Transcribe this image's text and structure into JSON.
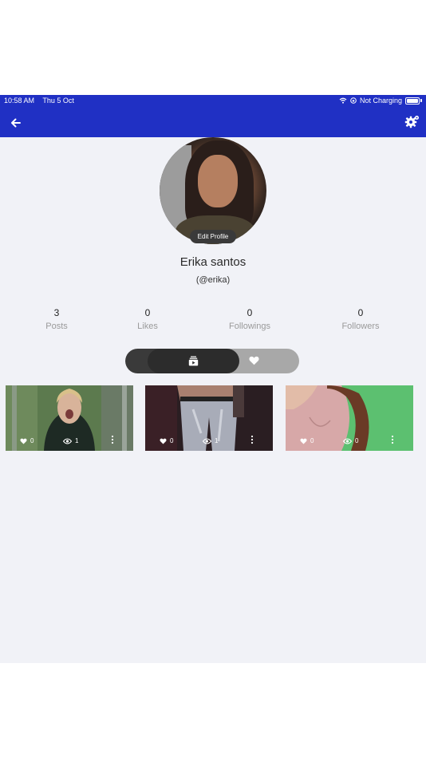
{
  "status_bar": {
    "time": "10:58 AM",
    "date": "Thu 5 Oct",
    "charging": "Not Charging"
  },
  "top_bar": {
    "back_icon": "arrow-left-icon",
    "settings_icon": "gear-icon"
  },
  "profile": {
    "edit_label": "Edit Profile",
    "name": "Erika santos",
    "handle": "(@erika)"
  },
  "stats": [
    {
      "value": "3",
      "label": "Posts"
    },
    {
      "value": "0",
      "label": "Likes"
    },
    {
      "value": "0",
      "label": "Followings"
    },
    {
      "value": "0",
      "label": "Followers"
    }
  ],
  "tabs": [
    {
      "icon": "video-library-icon",
      "active": true
    },
    {
      "icon": "heart-icon",
      "active": false
    }
  ],
  "videos": [
    {
      "likes": "0",
      "views": "1"
    },
    {
      "likes": "0",
      "views": "1"
    },
    {
      "likes": "0",
      "views": "0"
    }
  ],
  "colors": {
    "header": "#2030c4",
    "background": "#f1f2f7",
    "toggle_dark": "#2c2c2c",
    "toggle_light": "#a8a8a8"
  }
}
